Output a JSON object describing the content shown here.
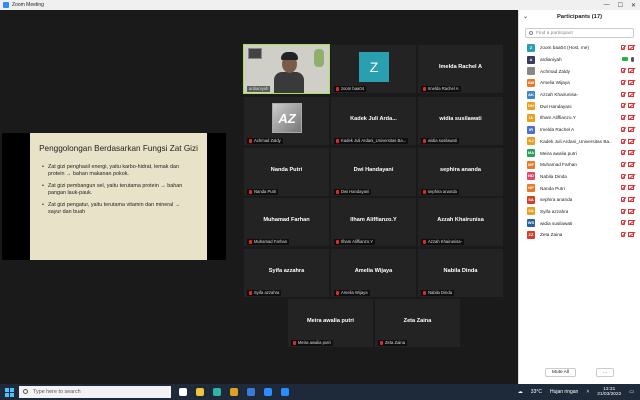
{
  "window": {
    "title": "Zoom Meeting"
  },
  "slide": {
    "title": "Penggolongan Berdasarkan Fungsi Zat Gizi",
    "bullets": [
      "Zat gizi penghasil energi, yaitu karbo-hidrat, lemak dan protein → bahan makanan pokok.",
      "Zat gizi pembangun sel, yaitu terutama protein → bahan pangan lauk-pauk.",
      "Zat gizi pengatur, yaitu terutama vitamin dan mineral → sayur dan buah"
    ]
  },
  "tiles": [
    {
      "center": "",
      "label": "ardianiyah"
    },
    {
      "center": "",
      "label": "zoom baa04"
    },
    {
      "center": "Imelda Rachel A",
      "label": "Imelda Rachel A"
    },
    {
      "center": "",
      "label": "Achmad Zaldy"
    },
    {
      "center": "Kadek Juli Arda...",
      "label": "Kadek Juli Ardani_Universitas Ba..."
    },
    {
      "center": "widia susilawati",
      "label": "widia susilawati"
    },
    {
      "center": "Nanda Putri",
      "label": "Nanda Putri"
    },
    {
      "center": "Dwi Handayani",
      "label": "Dwi Handayani"
    },
    {
      "center": "sephira ananda",
      "label": "sephira ananda"
    },
    {
      "center": "Muhamad Farhan",
      "label": "Muhamad Farhan"
    },
    {
      "center": "Ilham Aliffianzo.Y",
      "label": "Ilham Aliffianzo.Y"
    },
    {
      "center": "Azzah Khairunisa",
      "label": "Azzah Khairunisa-"
    },
    {
      "center": "Syifa azzahra",
      "label": "Syifa azzahra"
    },
    {
      "center": "Amelia Wijaya",
      "label": "Amelia Wijaya"
    },
    {
      "center": "Nabila Dinda",
      "label": "Nabila Dinda"
    },
    {
      "center": "Meira awalia putri",
      "label": "Meira awalia putri"
    },
    {
      "center": "Zeta Zaina",
      "label": "Zeta Zaina"
    }
  ],
  "tile_z_letter": "Z",
  "tile_az_letter": "AZ",
  "participants": {
    "title": "Participants (17)",
    "search_placeholder": "Find a participant",
    "items": [
      {
        "initials": "Z",
        "color": "#2a9fb0",
        "name": "zoom baa04 (Host, me)",
        "video": false
      },
      {
        "initials": "A",
        "color": "#3a3a5a",
        "name": "ardianiyah",
        "video": true
      },
      {
        "initials": "",
        "color": "#888888",
        "name": "Achmad Zaldy",
        "video": false
      },
      {
        "initials": "AW",
        "color": "#e87a2a",
        "name": "Amelia Wijaya",
        "video": false
      },
      {
        "initials": "AK",
        "color": "#3f88c5",
        "name": "Azzah Khairunisa-",
        "video": false
      },
      {
        "initials": "DH",
        "color": "#e8a020",
        "name": "Dwi Handayani",
        "video": false
      },
      {
        "initials": "IA",
        "color": "#e8a020",
        "name": "Ilham Aliffianzo.Y",
        "video": false
      },
      {
        "initials": "IR",
        "color": "#4a6fd0",
        "name": "Imelda Rachel A",
        "video": false
      },
      {
        "initials": "KJ",
        "color": "#e8a020",
        "name": "Kadek Juli Ardani_Universitas Ba...",
        "video": false
      },
      {
        "initials": "MA",
        "color": "#2aa05a",
        "name": "Meira awalia putri",
        "video": false
      },
      {
        "initials": "MF",
        "color": "#e87a2a",
        "name": "Muhamad Farhan",
        "video": false
      },
      {
        "initials": "ND",
        "color": "#e04a6a",
        "name": "Nabila Dinda",
        "video": false
      },
      {
        "initials": "NP",
        "color": "#e87a2a",
        "name": "Nanda Putri",
        "video": false
      },
      {
        "initials": "SA",
        "color": "#d0402a",
        "name": "sephira ananda",
        "video": false
      },
      {
        "initials": "SA",
        "color": "#e8a020",
        "name": "Syifa azzahra",
        "video": false
      },
      {
        "initials": "WS",
        "color": "#2a5fa0",
        "name": "widia susilawati",
        "video": false
      },
      {
        "initials": "ZZ",
        "color": "#d0402a",
        "name": "Zeta Zaina",
        "video": false
      }
    ],
    "mute_all_label": "Mute All",
    "more_label": "..."
  },
  "taskbar": {
    "search_placeholder": "Type here to search",
    "temperature": "33°C",
    "weather": "Hujan ringan",
    "time": "13:31",
    "date": "21/03/2022",
    "apps": [
      {
        "name": "task-view-icon",
        "color": "#ffffff"
      },
      {
        "name": "file-explorer-icon",
        "color": "#f3c13a"
      },
      {
        "name": "edge-icon",
        "color": "#2fb5a8"
      },
      {
        "name": "chrome-icon",
        "color": "#e0a020"
      },
      {
        "name": "store-icon",
        "color": "#3a7bd5"
      },
      {
        "name": "zoom-icon",
        "color": "#2d8cff"
      },
      {
        "name": "zoom-icon-2",
        "color": "#2d8cff"
      }
    ]
  }
}
